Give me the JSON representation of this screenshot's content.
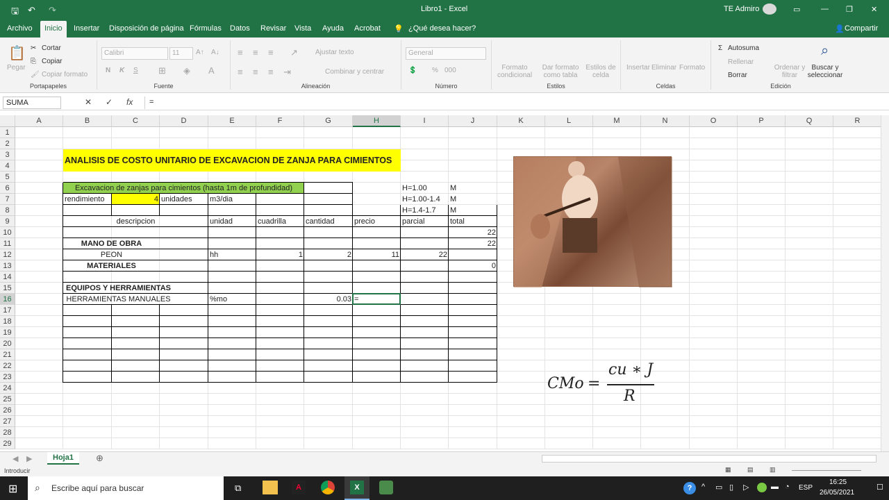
{
  "window": {
    "title": "Libro1  -  Excel",
    "user": "TE Admiro"
  },
  "menu": [
    "Archivo",
    "Inicio",
    "Insertar",
    "Disposición de página",
    "Fórmulas",
    "Datos",
    "Revisar",
    "Vista",
    "Ayuda",
    "Acrobat",
    "¿Qué desea hacer?"
  ],
  "share": "Compartir",
  "ribbon": {
    "clipboard": {
      "paste": "Pegar",
      "cut": "Cortar",
      "copy": "Copiar",
      "format": "Copiar formato",
      "label": "Portapapeles"
    },
    "font": {
      "name": "Calibri",
      "size": "11",
      "bold": "N",
      "italic": "K",
      "underline": "S",
      "label": "Fuente"
    },
    "align": {
      "wrap": "Ajustar texto",
      "merge": "Combinar y centrar",
      "label": "Alineación"
    },
    "number": {
      "format": "General",
      "label": "Número"
    },
    "styles": {
      "cond": "Formato condicional",
      "table": "Dar formato como tabla",
      "cell": "Estilos de celda",
      "label": "Estilos"
    },
    "cells": {
      "insert": "Insertar",
      "delete": "Eliminar",
      "format": "Formato",
      "label": "Celdas"
    },
    "editing": {
      "autosum": "Autosuma",
      "fill": "Rellenar",
      "clear": "Borrar",
      "sort": "Ordenar y filtrar",
      "find": "Buscar y seleccionar",
      "label": "Edición"
    }
  },
  "formula_bar": {
    "namebox": "SUMA",
    "content": "="
  },
  "columns": [
    "A",
    "B",
    "C",
    "D",
    "E",
    "F",
    "G",
    "H",
    "I",
    "J",
    "K",
    "L",
    "M",
    "N",
    "O",
    "P",
    "Q",
    "R"
  ],
  "rows": [
    "1",
    "2",
    "3",
    "4",
    "5",
    "6",
    "7",
    "8",
    "9",
    "10",
    "11",
    "12",
    "13",
    "14",
    "15",
    "16",
    "17",
    "18",
    "19",
    "20",
    "21",
    "22",
    "23",
    "24",
    "25",
    "26",
    "27",
    "28",
    "29"
  ],
  "cells": {
    "title": "ANALISIS DE COSTO UNITARIO DE EXCAVACION DE ZANJA PARA CIMIENTOS",
    "b6": "Excavacion de zanjas para cimientos (hasta 1m de profundidad)",
    "b7": "rendimiento",
    "c7": "4",
    "d7": "unidades",
    "e7": "m3/dia",
    "i6": "H=1.00",
    "j6": "M",
    "i7": "H=1.00-1.4",
    "j7": "M",
    "i8": "H=1.4-1.7",
    "j8": "M",
    "b9": "descripcion",
    "e9": "unidad",
    "f9": "cuadrilla",
    "g9": "cantidad",
    "h9": "precio",
    "i9": "parcial",
    "j9": "total",
    "j10": "22",
    "b11": "MANO DE OBRA",
    "j11": "22",
    "b12": "PEON",
    "e12": "hh",
    "f12": "1",
    "g12": "2",
    "h12": "11",
    "i12": "22",
    "b13": "MATERIALES",
    "j13": "0",
    "b15": "EQUIPOS Y HERRAMIENTAS",
    "b16": "HERRAMIENTAS MANUALES",
    "e16": "%mo",
    "g16": "0.03",
    "h16": "="
  },
  "formula": {
    "lhs": "CMo",
    "num": "cu ∗ J",
    "den": "R"
  },
  "sheet": "Hoja1",
  "status": "Introducir",
  "taskbar": {
    "search": "Escribe aquí para buscar",
    "time": "16:25",
    "date": "26/05/2021",
    "lang": "ESP"
  },
  "colors": {
    "excel_green": "#217346",
    "yellow": "#ffff00",
    "green_fill": "#92d050"
  }
}
